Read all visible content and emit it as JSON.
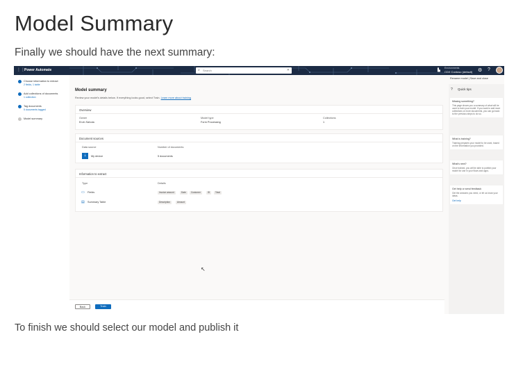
{
  "heading": "Model Summary",
  "intro": "Finally we should have the next summary:",
  "outro": "To finish we should select our model and publish it",
  "screenshot": {
    "app_name": "Power Automate",
    "search_placeholder": "Search",
    "environment_label": "Environments",
    "environment_name": "CDX Contoso (default)",
    "steps": [
      {
        "title": "Choose information to extract",
        "sub": "2 fields, 1 table",
        "done": true
      },
      {
        "title": "Add collections of documents",
        "sub": "1 collection",
        "done": true
      },
      {
        "title": "Tag documents",
        "sub": "5 documents tagged",
        "done": true
      },
      {
        "title": "Model summary",
        "sub": "",
        "done": false
      }
    ],
    "command_bar": "Rename model  |  Save and close",
    "summary_title": "Model summary",
    "summary_desc": "Review your model's details below. If everything looks good, select Train.",
    "summary_link": "Learn more about training",
    "overview": {
      "title": "Overview",
      "owner_label": "Owner",
      "owner_value": "Ervin Sahota",
      "type_label": "Model type",
      "type_value": "Form Processing",
      "collections_label": "Collections",
      "collections_value": "1"
    },
    "sources": {
      "title": "Document sources",
      "col_source": "Data source",
      "col_count": "Number of documents",
      "source_name": "My device",
      "source_count": "5 documents"
    },
    "extract": {
      "title": "Information to extract",
      "col_type": "Type",
      "col_details": "Details",
      "rows": [
        {
          "type": "Fields",
          "chips": [
            "Invoice amount",
            "Date",
            "Customer",
            "ID",
            "Total"
          ]
        },
        {
          "type": "Summary Table",
          "chips": [
            "Description",
            "Amount"
          ]
        }
      ]
    },
    "buttons": {
      "back": "Back",
      "train": "Train"
    },
    "tips": {
      "title": "Quick tips",
      "items": [
        {
          "title": "Missing something?",
          "body": "This page shows you a summary of what will be used to train your model. If you want to add more collections or more documents, you can go back to the previous steps to do so."
        },
        {
          "title": "What is training?",
          "body": "Training prepares your model to be used, based on the information you provided."
        },
        {
          "title": "What's next?",
          "body": "Once trained, you will be able to publish your model for use in your flows and apps."
        },
        {
          "title": "Get help or send feedback",
          "body": "Get the answers you need, or let us know your ideas.",
          "link": "Get help"
        }
      ]
    }
  }
}
